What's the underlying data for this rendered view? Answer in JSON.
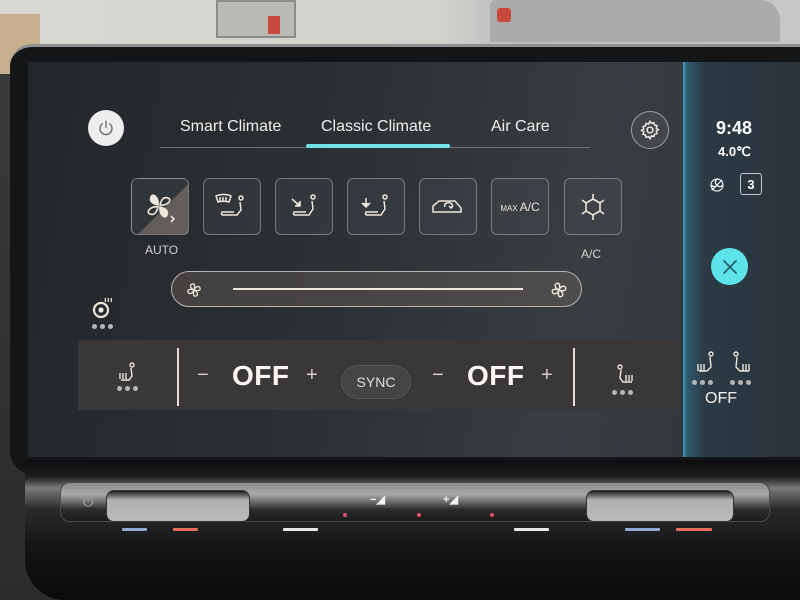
{
  "top_bar": {
    "tabs": [
      {
        "label": "Smart Climate",
        "active": false
      },
      {
        "label": "Classic Climate",
        "active": true
      },
      {
        "label": "Air Care",
        "active": false
      }
    ],
    "accent_color": "#73e0ea"
  },
  "status": {
    "time": "9:48",
    "outside_temp": "4.0℃",
    "gear": "3"
  },
  "function_buttons": [
    {
      "id": "auto",
      "icon": "fan-auto-icon",
      "label": "AUTO"
    },
    {
      "id": "defrost",
      "icon": "windshield-defrost-icon",
      "label": ""
    },
    {
      "id": "airflow-upper",
      "icon": "airflow-upper-body-icon",
      "label": ""
    },
    {
      "id": "airflow-feet",
      "icon": "airflow-footwell-icon",
      "label": ""
    },
    {
      "id": "recirculation",
      "icon": "air-recirculation-icon",
      "label": ""
    },
    {
      "id": "max-ac",
      "icon": "max-ac-icon",
      "text_small": "MAX",
      "text_main": "A/C",
      "label": ""
    },
    {
      "id": "ac",
      "icon": "snowflake-icon",
      "label": "A/C"
    }
  ],
  "fan_slider": {
    "level": 0
  },
  "climate": {
    "driver_temp": "OFF",
    "passenger_temp": "OFF",
    "minus": "−",
    "plus": "+",
    "sync_label": "SYNC"
  },
  "rear": {
    "label": "OFF"
  },
  "physical_panel": {
    "minus_label": "−",
    "plus_label": "+"
  }
}
